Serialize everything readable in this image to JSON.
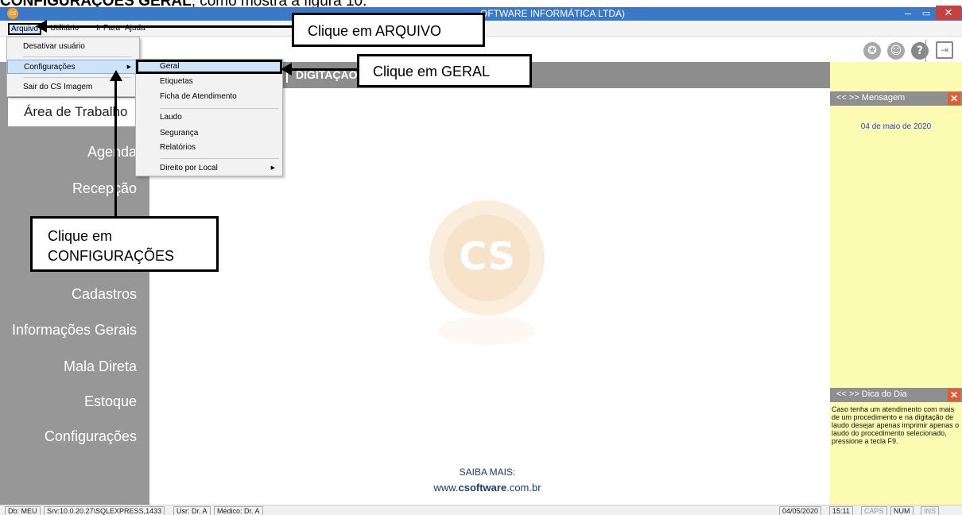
{
  "doc_caption": {
    "bold": "CONFIGURAÇÕES GERAL",
    "rest": ", como mostra a figura 10."
  },
  "titlebar": {
    "title": "OFTWARE INFORMÁTICA LTDA)",
    "logo": "cs",
    "min": "–",
    "max": "▭",
    "close": "✕"
  },
  "menubar": {
    "items": [
      "Arquivo",
      "Utilitário",
      "Ir Para",
      "Ajuda"
    ]
  },
  "arquivo_menu": {
    "items": [
      "Desativar usuário",
      "Configurações",
      "Sair do CS Imagem"
    ],
    "arrow": "▶"
  },
  "config_submenu": {
    "items": [
      "Geral",
      "Etiquetas",
      "Ficha de Atendimento",
      "Laudo",
      "Segurança",
      "Relatórios",
      "Direito por Local"
    ],
    "arrow": "▶"
  },
  "toolbar": {
    "icons": [
      "globe-icon",
      "user-support-icon",
      "help-icon",
      "exit-icon"
    ],
    "globe": "✪",
    "support": "☺",
    "help": "?",
    "exit": "⇥"
  },
  "banner": {
    "text": "DIGITAÇÃO"
  },
  "sidebar": {
    "work_area": "Área de Trabalho",
    "items": [
      "Agenda",
      "Recepção",
      "Cadastros",
      "Informações Gerais",
      "Mala Direta",
      "Estoque",
      "Configurações"
    ]
  },
  "main": {
    "watermark": "CS",
    "saiba": "SAIBA MAIS:",
    "site_pre": "www.",
    "site_bold": "csoftware",
    "site_post": ".com.br"
  },
  "right_panel": {
    "msg_nav": "<<   >> Mensagem",
    "msg_date": "04 de maio de 2020",
    "tip_nav": "<<   >> Dica do Dia",
    "close": "✕",
    "tip_text": "Caso tenha um atendimento com mais de um procedimento e na digitação de laudo desejar apenas imprimir apenas o laudo do procedimento selecionado, pressione a tecla F9."
  },
  "statusbar": {
    "db": "Db: MEU",
    "srv": "Srv:10.0.20.27\\SQLEXPRESS,1433",
    "usr": "Usr: Dr. A",
    "medico": "Médico: Dr. A",
    "date": "04/05/2020",
    "time": "15:11",
    "caps": "CAPS",
    "num": "NUM",
    "ins": "INS"
  },
  "callouts": {
    "arquivo": "Clique em ARQUIVO",
    "geral": "Clique em GERAL",
    "config_line1": "Clique em",
    "config_line2": "CONFIGURAÇÕES"
  }
}
